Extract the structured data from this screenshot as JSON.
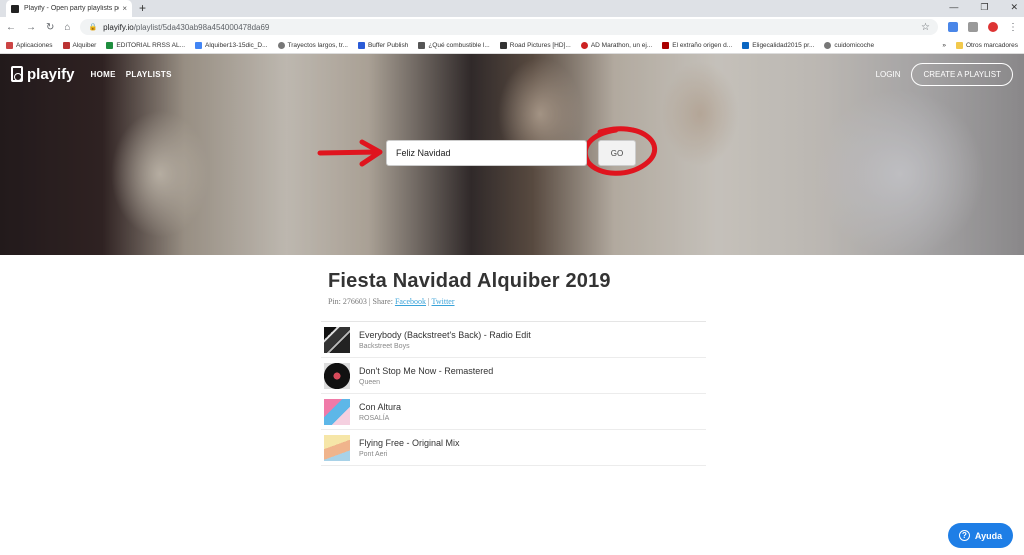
{
  "browser": {
    "tab_title": "Playify - Open party playlists po",
    "tab_close": "×",
    "new_tab": "+",
    "url_host": "playify.io",
    "url_path": "/playlist/5da430ab98a454000478da69",
    "bookmarks": [
      "Aplicaciones",
      "Alquiber",
      "EDITORIAL RRSS AL...",
      "Alquiber13-15dic_D...",
      "Trayectos largos, tr...",
      "Buffer Publish",
      "¿Qué combustible l...",
      "Road Pictures [HD]...",
      "AD Marathon, un ej...",
      "El extraño origen d...",
      "Eligecalidad2015 pr...",
      "cuidomicoche"
    ],
    "other_bookmarks": "Otros marcadores",
    "overflow": "»"
  },
  "site": {
    "logo_text": "playify",
    "nav": [
      "HOME",
      "PLAYLISTS"
    ],
    "login": "LOGIN",
    "create_playlist": "CREATE A PLAYLIST",
    "search_value": "Feliz Navidad",
    "go_label": "GO"
  },
  "playlist": {
    "title": "Fiesta Navidad Alquiber 2019",
    "pin_label": "Pin: 276603 | Share:",
    "share_facebook": "Facebook",
    "separator": "|",
    "share_twitter": "Twitter",
    "tracks": [
      {
        "name": "Everybody (Backstreet's Back) - Radio Edit",
        "artist": "Backstreet Boys"
      },
      {
        "name": "Don't Stop Me Now - Remastered",
        "artist": "Queen"
      },
      {
        "name": "Con Altura",
        "artist": "ROSALÍA"
      },
      {
        "name": "Flying Free - Original Mix",
        "artist": "Pont Aeri"
      }
    ]
  },
  "help": {
    "label": "Ayuda",
    "icon": "?"
  },
  "colors": {
    "accent": "#1e7ee6",
    "link": "#3aa3d9",
    "annotation": "#e0141e"
  }
}
